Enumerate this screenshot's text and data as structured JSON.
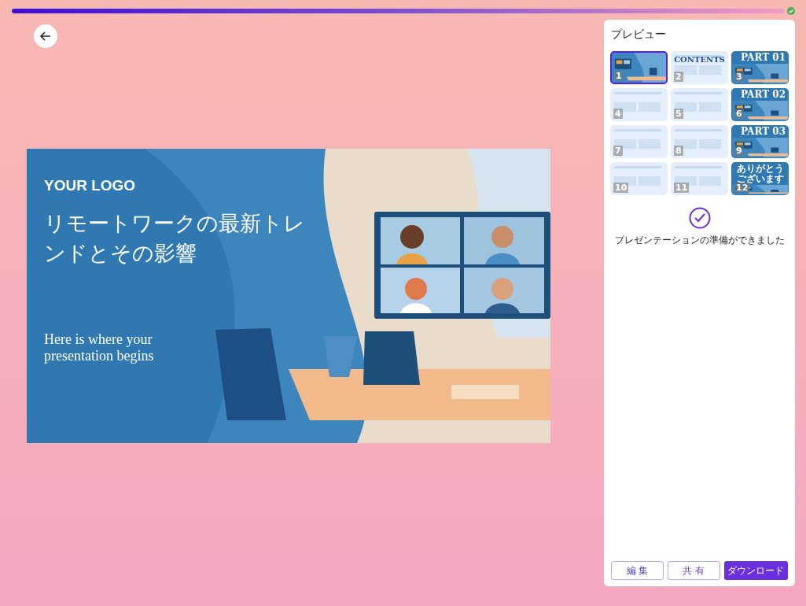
{
  "progress": {
    "level": 1,
    "done": true
  },
  "slide": {
    "logo": "YOUR LOGO",
    "title": "リモートワークの最新トレンドとその影響",
    "subtitle": "Here is where your presentation begins"
  },
  "preview": {
    "title": "プレビュー",
    "thumbnails": [
      {
        "number": "1",
        "selected": true
      },
      {
        "number": "2",
        "kind": "light",
        "heading": "CONTENTS",
        "selected": false
      },
      {
        "number": "3",
        "heading": "PART 01",
        "selected": false
      },
      {
        "number": "4",
        "kind": "light",
        "selected": false
      },
      {
        "number": "5",
        "kind": "light",
        "selected": false
      },
      {
        "number": "6",
        "heading": "PART 02",
        "selected": false
      },
      {
        "number": "7",
        "kind": "light",
        "selected": false
      },
      {
        "number": "8",
        "kind": "light",
        "selected": false
      },
      {
        "number": "9",
        "heading": "PART 03",
        "selected": false
      },
      {
        "number": "10",
        "kind": "light",
        "selected": false
      },
      {
        "number": "11",
        "kind": "light",
        "selected": false
      },
      {
        "number": "12",
        "heading": "ありがとうございます",
        "selected": false
      }
    ],
    "status": "プレゼンテーションの準備ができました",
    "buttons": [
      {
        "label": "編 集",
        "kind": "outline"
      },
      {
        "label": "共 有",
        "kind": "outline"
      },
      {
        "label": "ダウンロード",
        "kind": "primary"
      }
    ]
  }
}
